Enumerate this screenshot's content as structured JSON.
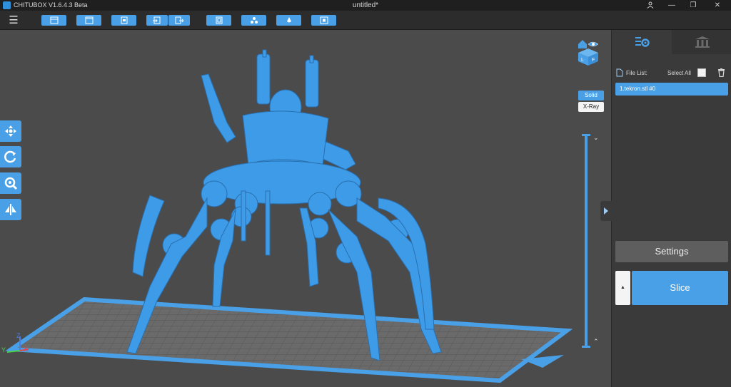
{
  "titlebar": {
    "app_title": "CHITUBOX V1.6.4.3 Beta",
    "document_title": "untitled*",
    "controls": {
      "account": "user-icon",
      "minimize": "minimize-icon",
      "restore": "restore-icon",
      "close": "close-icon"
    }
  },
  "toolbar": {
    "menu": "menu-icon",
    "buttons": [
      "new-project-icon",
      "open-project-icon",
      "open-file-icon",
      "import-icon",
      "export-icon",
      "auto-layout-icon",
      "arrange-icon",
      "support-icon",
      "hollow-icon"
    ]
  },
  "viewport": {
    "left_tools": [
      "move-icon",
      "rotate-icon",
      "scale-icon",
      "mirror-icon"
    ],
    "view_cube": {
      "letters": [
        "L",
        "F"
      ]
    },
    "render_modes": {
      "solid": "Solid",
      "xray": "X-Ray",
      "active": "Solid"
    },
    "axes": {
      "x": "X",
      "y": "Y",
      "z": "Z"
    }
  },
  "right_panel": {
    "tabs": [
      "settings-gear-icon",
      "support-pillars-icon"
    ],
    "file_list": {
      "label": "File List:",
      "select_all": "Select All",
      "files": [
        "1.tekron.stl  #0"
      ]
    },
    "settings_label": "Settings",
    "slice_label": "Slice",
    "slice_options": "▲"
  },
  "colors": {
    "accent": "#4aa0e6",
    "viewport_bg": "#4b4b4b",
    "panel_bg": "#3a3a3a",
    "model": "#3d9be8"
  }
}
